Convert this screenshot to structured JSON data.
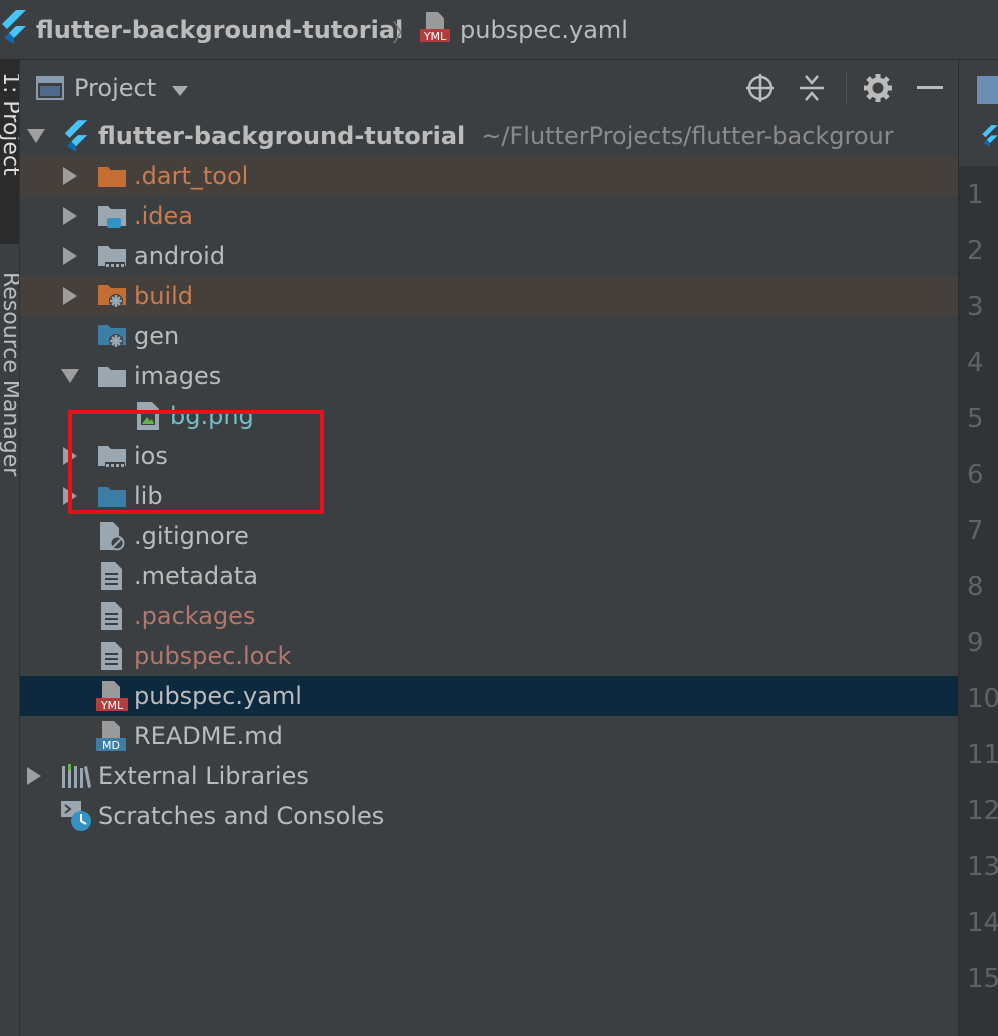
{
  "breadcrumb": {
    "project": "flutter-background-tutorial",
    "separator": "〉",
    "file": "pubspec.yaml",
    "file_badge": "YML"
  },
  "tool_strip": {
    "project_tab": "1: Project",
    "resource_tab": "Resource Manager"
  },
  "panel": {
    "view_selector": "Project",
    "icons": [
      "locate-icon",
      "collapse-all-icon",
      "gear-icon",
      "minimize-icon"
    ]
  },
  "tree": {
    "root": {
      "name": "flutter-background-tutorial",
      "path": "~/FlutterProjects/flutter-backgrour"
    },
    "items": [
      {
        "name": ".dart_tool",
        "icon": "folder-excluded-icon"
      },
      {
        "name": ".idea",
        "icon": "folder-idea-icon"
      },
      {
        "name": "android",
        "icon": "folder-module-icon"
      },
      {
        "name": "build",
        "icon": "folder-build-icon"
      },
      {
        "name": "gen",
        "icon": "folder-generated-icon"
      },
      {
        "name": "images",
        "icon": "folder-icon"
      },
      {
        "name": "bg.png",
        "icon": "image-file-icon"
      },
      {
        "name": "ios",
        "icon": "folder-module-icon"
      },
      {
        "name": "lib",
        "icon": "folder-source-icon"
      },
      {
        "name": ".gitignore",
        "icon": "ignore-file-icon"
      },
      {
        "name": ".metadata",
        "icon": "text-file-icon"
      },
      {
        "name": ".packages",
        "icon": "text-file-icon"
      },
      {
        "name": "pubspec.lock",
        "icon": "text-file-icon"
      },
      {
        "name": "pubspec.yaml",
        "icon": "yaml-file-icon",
        "badge": "YML"
      },
      {
        "name": "README.md",
        "icon": "markdown-file-icon",
        "badge": "MD"
      }
    ],
    "external_libraries": "External Libraries",
    "scratches": "Scratches and Consoles"
  },
  "editor": {
    "line_numbers": [
      "1",
      "2",
      "3",
      "4",
      "5",
      "6",
      "7",
      "8",
      "9",
      "10",
      "11",
      "12",
      "13",
      "14",
      "15"
    ]
  },
  "colors": {
    "background": "#3c3f41",
    "selected_row": "#0d293e",
    "excluded_row": "#45403b",
    "flutter_blue": "#47c5fb",
    "highlight_border": "#e8101a"
  }
}
